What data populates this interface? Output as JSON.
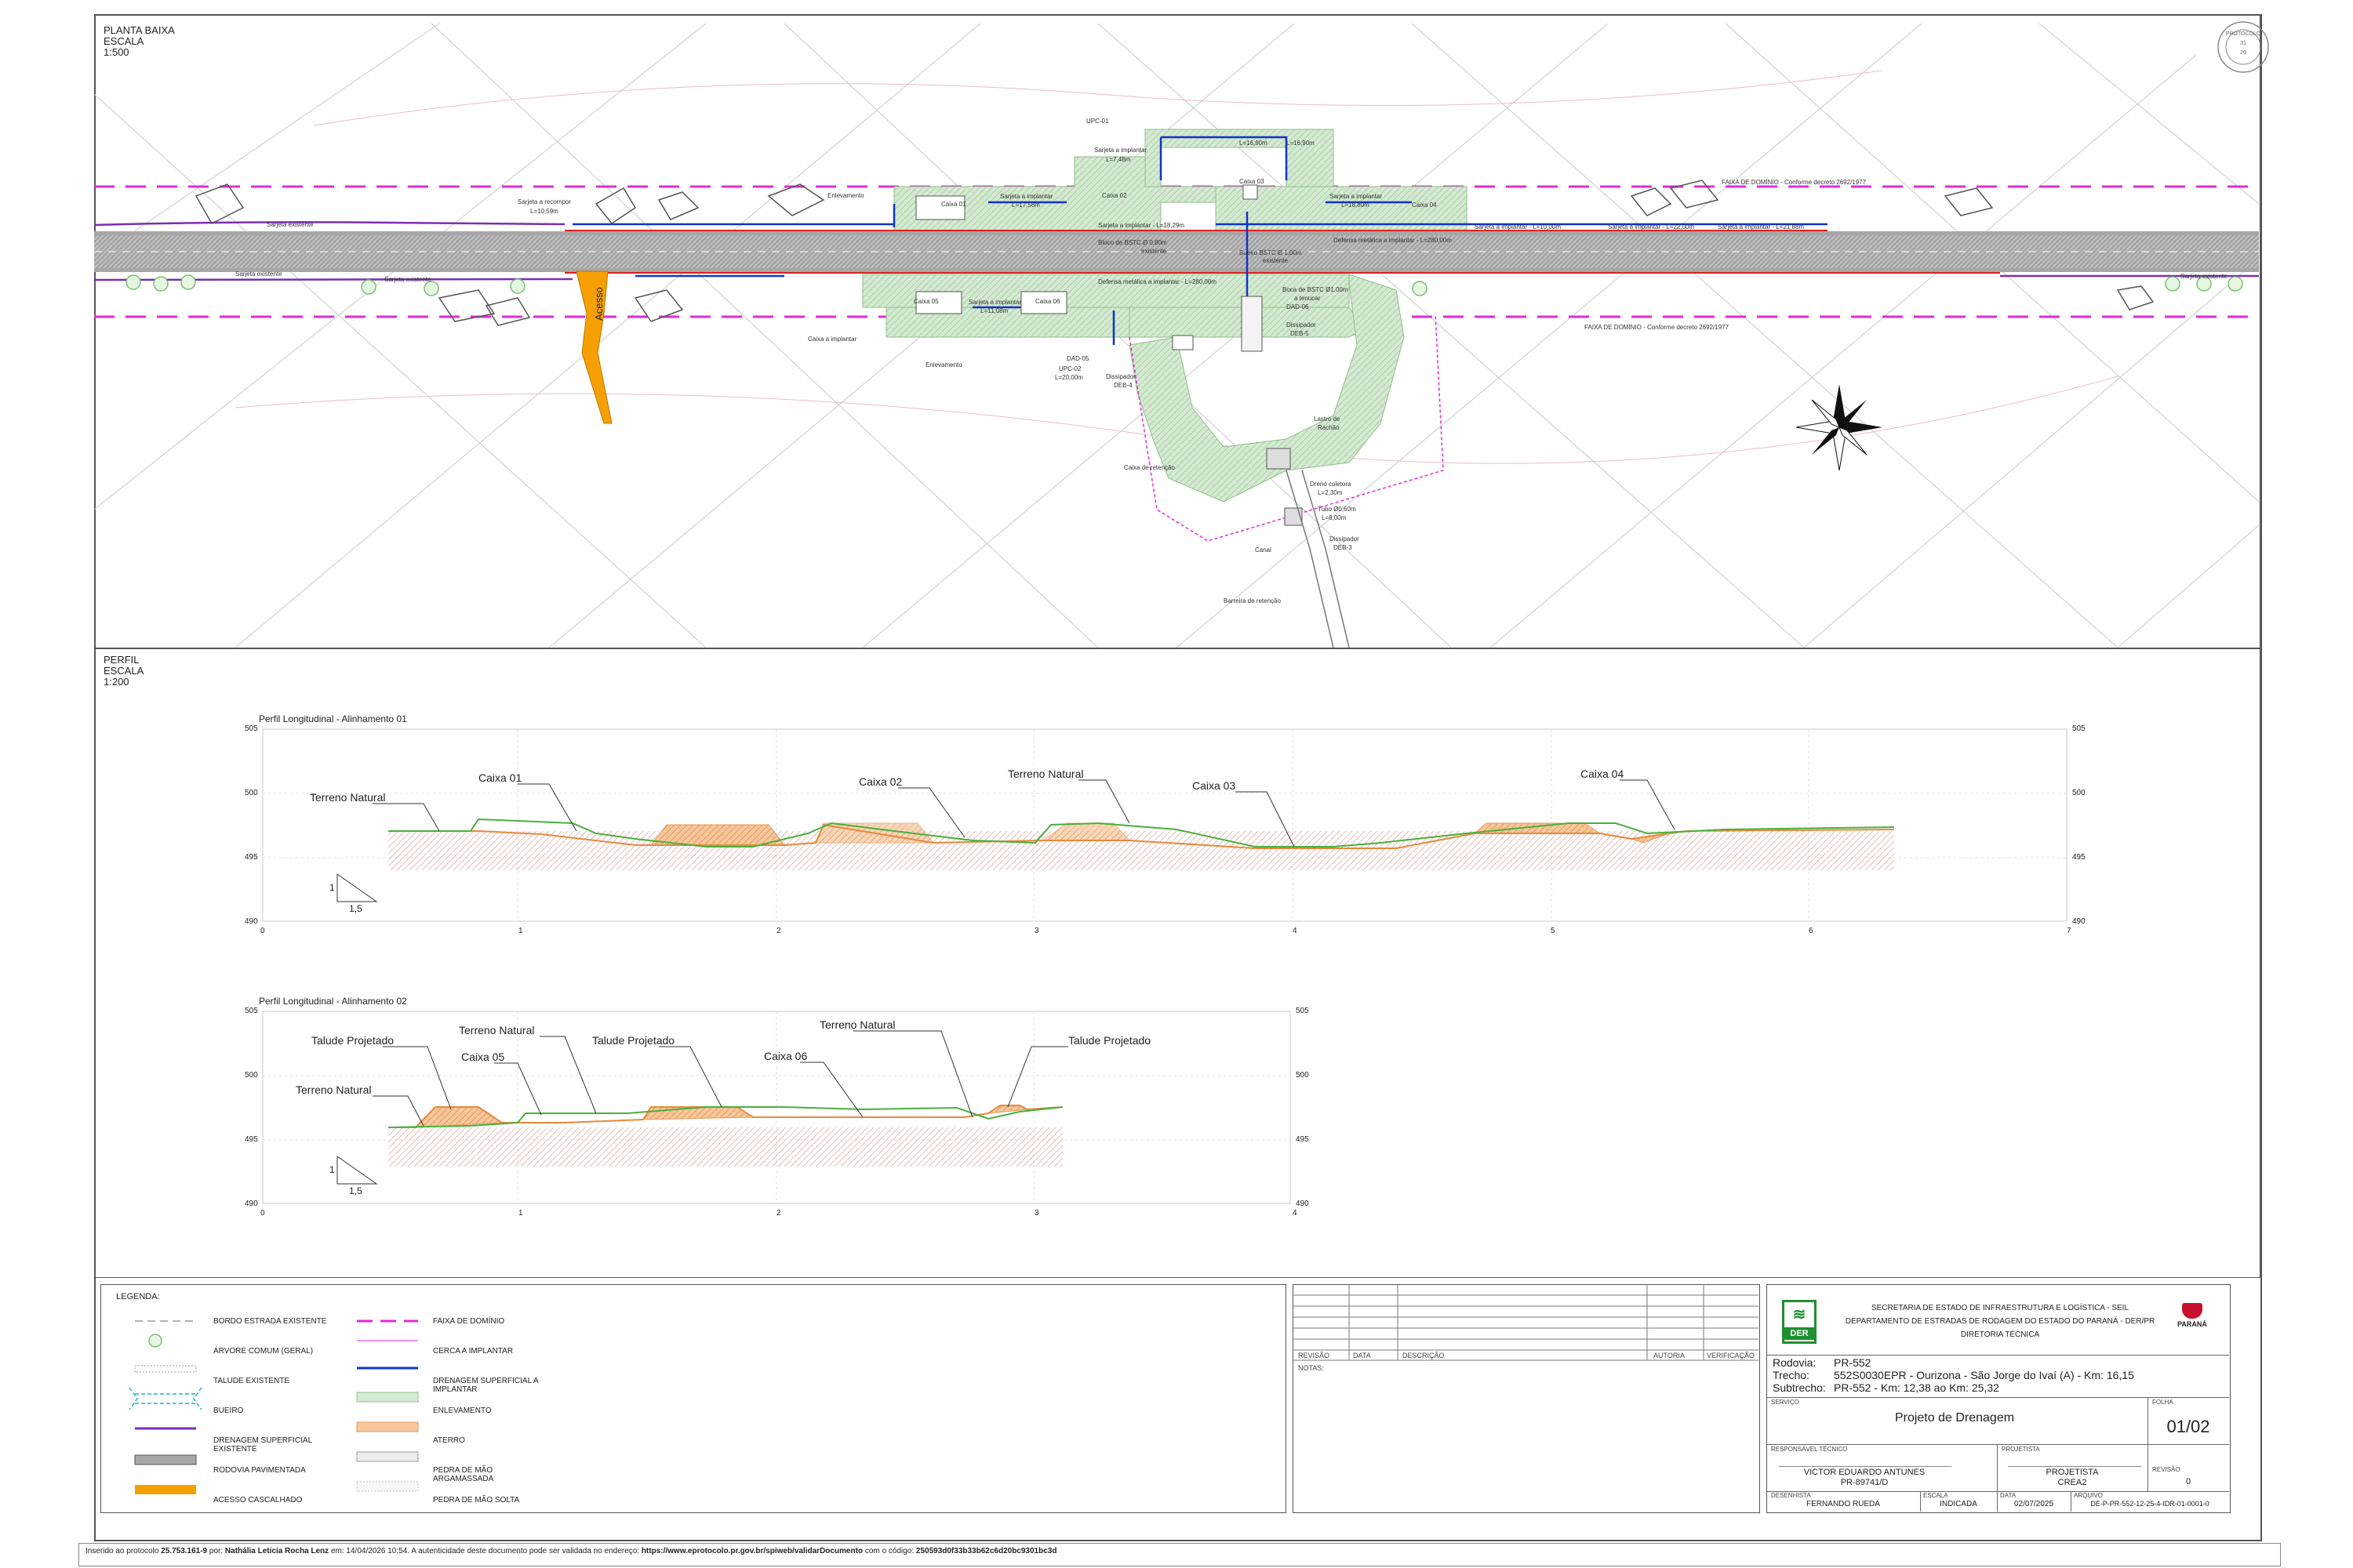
{
  "plan": {
    "title": "PLANTA BAIXA",
    "scale_label": "ESCALA",
    "scale": "1:500",
    "acesso": "Acesso",
    "labels": [
      {
        "t": "UPC-01",
        "x": 1385,
        "y": 150
      },
      {
        "t": "L=16,90m",
        "x": 1580,
        "y": 178
      },
      {
        "t": "L=16,90m",
        "x": 1640,
        "y": 178
      },
      {
        "t": "Sarjeta a implantar",
        "x": 1395,
        "y": 187
      },
      {
        "t": "L=7,48m",
        "x": 1410,
        "y": 199
      },
      {
        "t": "FAIXA DE DOMÍNIO - Conforme decreto 2692/1977",
        "x": 2195,
        "y": 228
      },
      {
        "t": "Sarjeta a recompor",
        "x": 660,
        "y": 253
      },
      {
        "t": "L=10,59m",
        "x": 676,
        "y": 265
      },
      {
        "t": "Enlevamento",
        "x": 1055,
        "y": 245
      },
      {
        "t": "Caixa 01",
        "x": 1200,
        "y": 256
      },
      {
        "t": "Sarjeta a implantar",
        "x": 1275,
        "y": 246
      },
      {
        "t": "L=17,58m",
        "x": 1290,
        "y": 257
      },
      {
        "t": "Caixa 02",
        "x": 1405,
        "y": 245
      },
      {
        "t": "Caixa 03",
        "x": 1580,
        "y": 227
      },
      {
        "t": "Sarjeta a implantar",
        "x": 1695,
        "y": 246
      },
      {
        "t": "L=18,80m",
        "x": 1710,
        "y": 257
      },
      {
        "t": "Caixa 04",
        "x": 1800,
        "y": 257
      },
      {
        "t": "Sarjeta a implantar - L=10,00m",
        "x": 1880,
        "y": 285
      },
      {
        "t": "Sarjeta a implantar - L=22,00m",
        "x": 2050,
        "y": 285
      },
      {
        "t": "Sarjeta a implantar - L=21,88m",
        "x": 2190,
        "y": 285
      },
      {
        "t": "Sarjeta existente",
        "x": 340,
        "y": 282
      },
      {
        "t": "Sarjeta a implantar - L=18,29m",
        "x": 1400,
        "y": 283
      },
      {
        "t": "Defensa metálica a implantar - L=280,00m",
        "x": 1700,
        "y": 302
      },
      {
        "t": "Sarjeta existente",
        "x": 300,
        "y": 345
      },
      {
        "t": "Sarjeta existente",
        "x": 490,
        "y": 352
      },
      {
        "t": "Sarjeta existente",
        "x": 2780,
        "y": 348
      },
      {
        "t": "Bloco de BSTC Ø 0,80m",
        "x": 1400,
        "y": 305
      },
      {
        "t": "existente",
        "x": 1455,
        "y": 316
      },
      {
        "t": "Bueiro BSTC Ø 1,00m",
        "x": 1580,
        "y": 318
      },
      {
        "t": "existente",
        "x": 1610,
        "y": 328
      },
      {
        "t": "Defensa metálica a implantar - L=280,00m",
        "x": 1400,
        "y": 355
      },
      {
        "t": "Boca de BSTC Ø1,00m",
        "x": 1635,
        "y": 365
      },
      {
        "t": "a tenucar",
        "x": 1650,
        "y": 376
      },
      {
        "t": "DAD-06",
        "x": 1640,
        "y": 387
      },
      {
        "t": "Dissipador",
        "x": 1640,
        "y": 410
      },
      {
        "t": "DEB-5",
        "x": 1645,
        "y": 421
      },
      {
        "t": "Caixa 05",
        "x": 1165,
        "y": 380
      },
      {
        "t": "Sarjeta a implantar",
        "x": 1235,
        "y": 381
      },
      {
        "t": "L=11,08m",
        "x": 1250,
        "y": 392
      },
      {
        "t": "Caixa 06",
        "x": 1320,
        "y": 380
      },
      {
        "t": "FAIXA DE DOMÍNIO - Conforme decreto 2692/1977",
        "x": 2020,
        "y": 413
      },
      {
        "t": "Caixa a implantar",
        "x": 1030,
        "y": 428
      },
      {
        "t": "DAD-05",
        "x": 1360,
        "y": 453
      },
      {
        "t": "UPC-02",
        "x": 1350,
        "y": 466
      },
      {
        "t": "L=20,00m",
        "x": 1345,
        "y": 477
      },
      {
        "t": "Dissipador",
        "x": 1410,
        "y": 476
      },
      {
        "t": "DEB-4",
        "x": 1420,
        "y": 487
      },
      {
        "t": "Enlevamento",
        "x": 1180,
        "y": 461
      },
      {
        "t": "Lastro de",
        "x": 1675,
        "y": 530
      },
      {
        "t": "Rachão",
        "x": 1680,
        "y": 541
      },
      {
        "t": "Caixa de retenção",
        "x": 1433,
        "y": 592
      },
      {
        "t": "Dreno coletora",
        "x": 1670,
        "y": 613
      },
      {
        "t": "L=2,30m",
        "x": 1680,
        "y": 624
      },
      {
        "t": "Tubo Ø0,60m",
        "x": 1680,
        "y": 645
      },
      {
        "t": "L=8,00m",
        "x": 1685,
        "y": 656
      },
      {
        "t": "Dissipador",
        "x": 1695,
        "y": 683
      },
      {
        "t": "DEB-3",
        "x": 1700,
        "y": 694
      },
      {
        "t": "Canal",
        "x": 1600,
        "y": 697
      },
      {
        "t": "Barreira de retenção",
        "x": 1560,
        "y": 762
      }
    ]
  },
  "profile_section": {
    "title": "PERFIL",
    "scale_label": "ESCALA",
    "scale": "1:200"
  },
  "profile1": {
    "title": "Perfil Longitudinal - Alinhamento 01",
    "y_ticks": [
      "505",
      "500",
      "495",
      "490"
    ],
    "x_ticks": [
      "0",
      "1",
      "2",
      "3",
      "4",
      "5",
      "6",
      "7"
    ],
    "labels": [
      {
        "t": "Caixa 01",
        "x": 610,
        "y": 1000
      },
      {
        "t": "Caixa 02",
        "x": 1095,
        "y": 1005
      },
      {
        "t": "Terreno Natural",
        "x": 1285,
        "y": 995
      },
      {
        "t": "Caixa 03",
        "x": 1520,
        "y": 1010
      },
      {
        "t": "Caixa 04",
        "x": 2015,
        "y": 995
      },
      {
        "t": "Terreno Natural",
        "x": 395,
        "y": 1025
      }
    ],
    "slope_v": "1",
    "slope_h": "1,5"
  },
  "profile2": {
    "title": "Perfil Longitudinal - Alinhamento 02",
    "y_ticks": [
      "505",
      "500",
      "495",
      "490"
    ],
    "x_ticks": [
      "0",
      "1",
      "2",
      "3",
      "4"
    ],
    "labels": [
      {
        "t": "Talude Projetado",
        "x": 397,
        "y": 1335
      },
      {
        "t": "Terreno Natural",
        "x": 585,
        "y": 1322
      },
      {
        "t": "Talude Projetado",
        "x": 755,
        "y": 1335
      },
      {
        "t": "Terreno Natural",
        "x": 1045,
        "y": 1315
      },
      {
        "t": "Talude Projetado",
        "x": 1362,
        "y": 1335
      },
      {
        "t": "Caixa 05",
        "x": 588,
        "y": 1356
      },
      {
        "t": "Caixa 06",
        "x": 974,
        "y": 1355
      },
      {
        "t": "Terreno Natural",
        "x": 377,
        "y": 1398
      }
    ],
    "slope_v": "1",
    "slope_h": "1,5"
  },
  "legend": {
    "title": "LEGENDA:",
    "left": [
      "BORDO ESTRADA EXISTENTE",
      "ÁRVORE COMUM (GERAL)",
      "TALUDE EXISTENTE",
      "BUEIRO",
      "DRENAGEM SUPERFICIAL EXISTENTE",
      "RODOVIA PAVIMENTADA",
      "ACESSO CASCALHADO"
    ],
    "right": [
      "FAIXA DE DOMÍNIO",
      "CERCA A IMPLANTAR",
      "DRENAGEM SUPERFICIAL A IMPLANTAR",
      "ENLEVAMENTO",
      "ATERRO",
      "PEDRA DE MÃO ARGAMASSADA",
      "PEDRA DE MÃO SOLTA"
    ]
  },
  "revisions": {
    "headers": [
      "REVISÃO",
      "DATA",
      "DESCRIÇÃO",
      "AUTORIA",
      "VERIFICAÇÃO"
    ],
    "notes": "NOTAS:"
  },
  "titleblock": {
    "logo": "DER",
    "org_line1": "SECRETARIA DE ESTADO DE INFRAESTRUTURA E LOGÍSTICA - SEIL",
    "org_line2": "DEPARTAMENTO DE ESTRADAS DE RODAGEM DO ESTADO DO PARANÁ - DER/PR",
    "org_line3": "DIRETORIA TÉCNICA",
    "state": "PARANÁ",
    "rodovia_label": "Rodovia:",
    "rodovia": "PR-552",
    "trecho_label": "Trecho:",
    "trecho": "552S0030EPR - Ourizona - São Jorge do Ivaí (A) - Km: 16,15",
    "subtrecho_label": "Subtrecho:",
    "subtrecho": "PR-552 - Km: 12,38 ao Km: 25,32",
    "servico_label": "SERVIÇO",
    "servico": "Projeto de Drenagem",
    "folha_label": "FOLHA",
    "folha": "01/02",
    "resp_label": "RESPONSÁVEL TÉCNICO",
    "resp_name": "VICTOR EDUARDO ANTUNES",
    "resp_crea": "PR-89741/D",
    "proj_label": "PROJETISTA",
    "proj_name": "PROJETISTA",
    "proj_crea": "CREA2",
    "rev_label": "REVISÃO",
    "rev": "0",
    "des_label": "DESENHISTA",
    "des": "FERNANDO RUEDA",
    "esc_label": "ESCALA",
    "esc": "INDICADA",
    "data_label": "DATA",
    "data": "02/07/2025",
    "arq_label": "ARQUIVO",
    "arq": "DE-P-PR-552-12-25-4-IDR-01-0001-0"
  },
  "stamp": {
    "top": "PROTOCOLO",
    "mid": "31",
    "bot": "26"
  },
  "footer": {
    "p1": "Inserido ao protocolo ",
    "protocol": "25.753.161-9",
    "p2": " por: ",
    "user": "Nathália Leticia Rocha Lenz",
    "p3": " em: 14/04/2026 10:54. A autenticidade deste documento pode ser validada no endereço: ",
    "url": "https://www.eprotocolo.pr.gov.br/spiweb/validarDocumento",
    "p4": " com o código: ",
    "code": "250593d0f33b33b62c6d20bc9301bc3d"
  }
}
